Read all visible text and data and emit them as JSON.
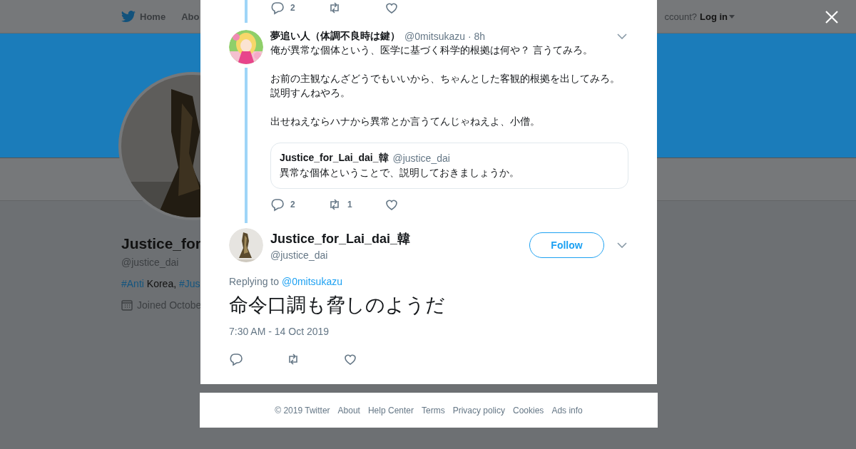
{
  "nav": {
    "items": [
      {
        "label": "Home",
        "kind": "home"
      },
      {
        "label": "Abo",
        "kind": "plain"
      }
    ],
    "login_prompt": "ccount?",
    "login": "Log in"
  },
  "profile": {
    "name": "Justice_for",
    "handle": "@justice_dai",
    "bio": [
      {
        "text": "#Anti",
        "kind": "hashtag"
      },
      {
        "text": " Korea, ",
        "kind": "text"
      },
      {
        "text": "#Jus",
        "kind": "hashtag"
      }
    ],
    "joined": "Joined Octobe"
  },
  "modal": {
    "previous_actions": [
      {
        "kind": "reply",
        "count": "2"
      },
      {
        "kind": "retweet"
      },
      {
        "kind": "like"
      }
    ],
    "reply_tweet": {
      "name": "夢追い人（体調不良時は鍵）",
      "handle": "@0mitsukazu",
      "time": "· 8h",
      "paragraphs": [
        {
          "lines": [
            "俺が異常な個体という、医学に基づく科学的根拠は何や？ 言うてみろ。"
          ]
        },
        {
          "lines": [
            "お前の主観なんざどうでもいいから、ちゃんとした客観的根拠を出してみろ。",
            "説明すんねやろ。"
          ]
        },
        {
          "lines": [
            "出せねえならハナから異常とか言うてんじゃねえよ、小僧。"
          ]
        }
      ],
      "quote": {
        "name": "Justice_for_Lai_dai_韓",
        "handle": "@justice_dai",
        "text": "異常な個体ということで、説明しておきましょうか。"
      },
      "actions": [
        {
          "kind": "reply",
          "count": "2"
        },
        {
          "kind": "retweet",
          "count": "1"
        },
        {
          "kind": "like"
        }
      ]
    },
    "main_tweet": {
      "name": "Justice_for_Lai_dai_韓",
      "handle": "@justice_dai",
      "follow": "Follow",
      "replying_to": "Replying to",
      "reply_handle": "@0mitsukazu",
      "text": "命令口調も脅しのようだ",
      "timestamp": "7:30 AM - 14 Oct 2019",
      "actions": [
        {
          "kind": "reply"
        },
        {
          "kind": "retweet"
        },
        {
          "kind": "like"
        }
      ]
    },
    "footer": [
      "© 2019 Twitter",
      "About",
      "Help Center",
      "Terms",
      "Privacy policy",
      "Cookies",
      "Ads info"
    ]
  }
}
